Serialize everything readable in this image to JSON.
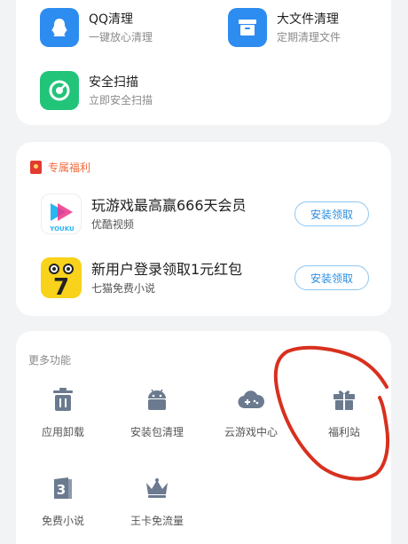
{
  "tools": [
    {
      "title": "QQ清理",
      "subtitle": "一键放心清理",
      "icon": "qq-penguin-icon",
      "color": "#2d8cf0"
    },
    {
      "title": "大文件清理",
      "subtitle": "定期清理文件",
      "icon": "archive-box-icon",
      "color": "#2d8cf0"
    },
    {
      "title": "安全扫描",
      "subtitle": "立即安全扫描",
      "icon": "scan-gauge-icon",
      "color": "#22c47a"
    }
  ],
  "benefits": {
    "title": "专属福利",
    "items": [
      {
        "title": "玩游戏最高赢666天会员",
        "subtitle": "优酷视频",
        "button": "安装领取",
        "logo_text": "YOUKU"
      },
      {
        "title": "新用户登录领取1元红包",
        "subtitle": "七猫免费小说",
        "button": "安装领取",
        "logo_text": "7"
      }
    ]
  },
  "more": {
    "title": "更多功能",
    "items": [
      {
        "label": "应用卸载",
        "icon": "trash-icon"
      },
      {
        "label": "安装包清理",
        "icon": "android-icon"
      },
      {
        "label": "云游戏中心",
        "icon": "cloud-gamepad-icon"
      },
      {
        "label": "福利站",
        "icon": "gift-icon"
      },
      {
        "label": "免费小说",
        "icon": "book-icon"
      },
      {
        "label": "王卡免流量",
        "icon": "crown-icon"
      }
    ]
  },
  "colors": {
    "accent": "#2a8ee0",
    "icon_gray": "#6b7a8f",
    "annotation_red": "#d8301f"
  }
}
